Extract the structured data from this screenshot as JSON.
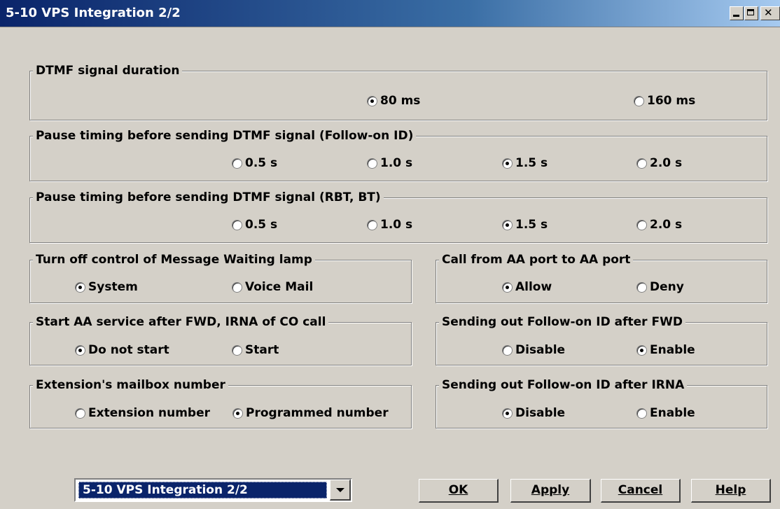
{
  "window": {
    "title": "5-10 VPS Integration 2/2"
  },
  "groups": {
    "dtmf_duration": {
      "legend": "DTMF signal duration",
      "options": [
        "80 ms",
        "160 ms"
      ],
      "selected": "80 ms"
    },
    "pause_follow_on": {
      "legend": "Pause timing before sending DTMF signal (Follow-on ID)",
      "options": [
        "0.5 s",
        "1.0 s",
        "1.5 s",
        "2.0 s"
      ],
      "selected": "1.5 s"
    },
    "pause_rbt_bt": {
      "legend": "Pause timing before sending DTMF signal (RBT, BT)",
      "options": [
        "0.5 s",
        "1.0 s",
        "1.5 s",
        "2.0 s"
      ],
      "selected": "1.5 s"
    },
    "mw_lamp": {
      "legend": "Turn off control of Message Waiting lamp",
      "options": [
        "System",
        "Voice Mail"
      ],
      "selected": "System"
    },
    "aa_to_aa": {
      "legend": "Call from AA port to AA port",
      "options": [
        "Allow",
        "Deny"
      ],
      "selected": "Allow"
    },
    "start_aa": {
      "legend": "Start AA service after FWD, IRNA of CO call",
      "options": [
        "Do not start",
        "Start"
      ],
      "selected": "Do not start"
    },
    "follow_fwd": {
      "legend": "Sending out Follow-on ID after FWD",
      "options": [
        "Disable",
        "Enable"
      ],
      "selected": "Enable"
    },
    "mailbox": {
      "legend": "Extension's mailbox number",
      "options": [
        "Extension number",
        "Programmed number"
      ],
      "selected": "Programmed number"
    },
    "follow_irna": {
      "legend": "Sending out Follow-on ID after IRNA",
      "options": [
        "Disable",
        "Enable"
      ],
      "selected": "Disable"
    }
  },
  "footer": {
    "page_select": "5-10 VPS Integration 2/2",
    "ok": "OK",
    "apply": "Apply",
    "cancel": "Cancel",
    "help": "Help"
  }
}
